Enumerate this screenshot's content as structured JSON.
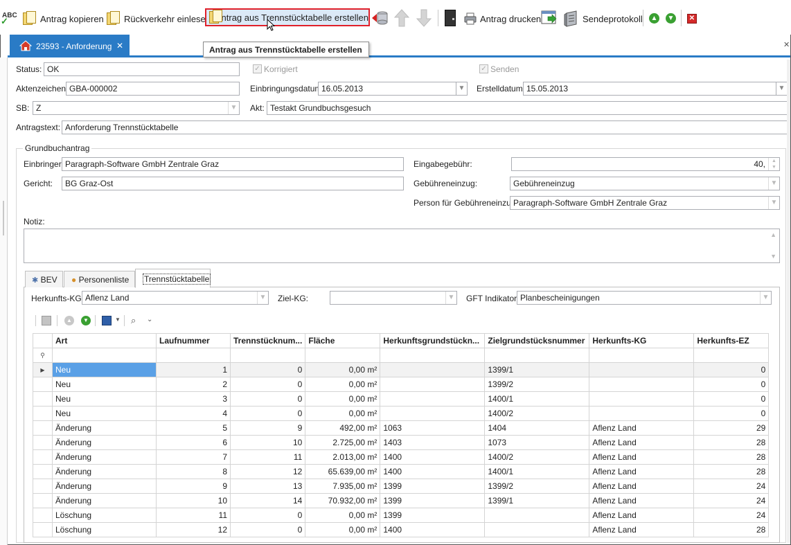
{
  "toolbar": {
    "abc": "ABC",
    "copy_label": "Antrag kopieren",
    "return_label": "Rückverkehr einlesen",
    "create_label": "Antrag aus Trennstücktabelle erstellen",
    "print_label": "Antrag drucken",
    "protocol_label": "Sendeprotokoll",
    "tooltip": "Antrag aus Trennstücktabelle erstellen"
  },
  "doc_tab": {
    "title": "23593 - Anforderung ",
    "close": "✕"
  },
  "form": {
    "status_label": "Status:",
    "status_value": "OK",
    "korrigiert_label": "Korrigiert",
    "senden_label": "Senden",
    "aktenzeichen_label": "Aktenzeichen:",
    "aktenzeichen_value": "GBA-000002",
    "einbringungsdatum_label": "Einbringungsdatum:",
    "einbringungsdatum_value": "16.05.2013",
    "erstelldatum_label": "Erstelldatum:",
    "erstelldatum_value": "15.05.2013",
    "sb_label": "SB:",
    "sb_value": "Z",
    "akt_label": "Akt:",
    "akt_value": "Testakt Grundbuchsgesuch",
    "antragstext_label": "Antragstext:",
    "antragstext_value": "Anforderung Trennstücktabelle"
  },
  "grundbuch": {
    "group_title": "Grundbuchantrag",
    "einbringer_label": "Einbringer:",
    "einbringer_value": "Paragraph-Software GmbH Zentrale Graz",
    "gericht_label": "Gericht:",
    "gericht_value": "BG Graz-Ost",
    "eingabe_label": "Eingabegebühr:",
    "eingabe_value": "40,",
    "einzug_label": "Gebühreneinzug:",
    "einzug_value": "Gebühreneinzug",
    "person_label": "Person für Gebühreneinzug:",
    "person_value": "Paragraph-Software GmbH Zentrale Graz",
    "notiz_label": "Notiz:"
  },
  "tabs": {
    "bev": "BEV",
    "personen": "Personenliste",
    "trenn": "Trennstücktabelle"
  },
  "filter": {
    "herkunft_label": "Herkunfts-KG:",
    "herkunft_value": "Aflenz Land",
    "ziel_label": "Ziel-KG:",
    "ziel_value": "",
    "gft_label": "GFT Indikator:",
    "gft_value": "Planbescheinigungen"
  },
  "grid": {
    "headers": [
      "Art",
      "Laufnummer",
      "Trennstücknum...",
      "Fläche",
      "Herkunftsgrundstückn...",
      "Zielgrundstücksnummer",
      "Herkunfts-KG",
      "Herkunfts-EZ"
    ],
    "rows": [
      [
        "Neu",
        "1",
        "0",
        "0,00 m²",
        "",
        "1399/1",
        "",
        "0"
      ],
      [
        "Neu",
        "2",
        "0",
        "0,00 m²",
        "",
        "1399/2",
        "",
        "0"
      ],
      [
        "Neu",
        "3",
        "0",
        "0,00 m²",
        "",
        "1400/1",
        "",
        "0"
      ],
      [
        "Neu",
        "4",
        "0",
        "0,00 m²",
        "",
        "1400/2",
        "",
        "0"
      ],
      [
        "Änderung",
        "5",
        "9",
        "492,00 m²",
        "1063",
        "1404",
        "Aflenz Land",
        "29"
      ],
      [
        "Änderung",
        "6",
        "10",
        "2.725,00 m²",
        "1403",
        "1073",
        "Aflenz Land",
        "28"
      ],
      [
        "Änderung",
        "7",
        "11",
        "2.013,00 m²",
        "1400",
        "1400/2",
        "Aflenz Land",
        "28"
      ],
      [
        "Änderung",
        "8",
        "12",
        "65.639,00 m²",
        "1400",
        "1400/1",
        "Aflenz Land",
        "28"
      ],
      [
        "Änderung",
        "9",
        "13",
        "7.935,00 m²",
        "1399",
        "1399/2",
        "Aflenz Land",
        "24"
      ],
      [
        "Änderung",
        "10",
        "14",
        "70.932,00 m²",
        "1399",
        "1399/1",
        "Aflenz Land",
        "24"
      ],
      [
        "Löschung",
        "11",
        "0",
        "0,00 m²",
        "1399",
        "",
        "Aflenz Land",
        "24"
      ],
      [
        "Löschung",
        "12",
        "0",
        "0,00 m²",
        "1400",
        "",
        "Aflenz Land",
        "28"
      ]
    ]
  },
  "colors": {
    "accent": "#2a7bc6",
    "highlight_border": "#e0202a",
    "selected_cell": "#5aa0e6"
  }
}
